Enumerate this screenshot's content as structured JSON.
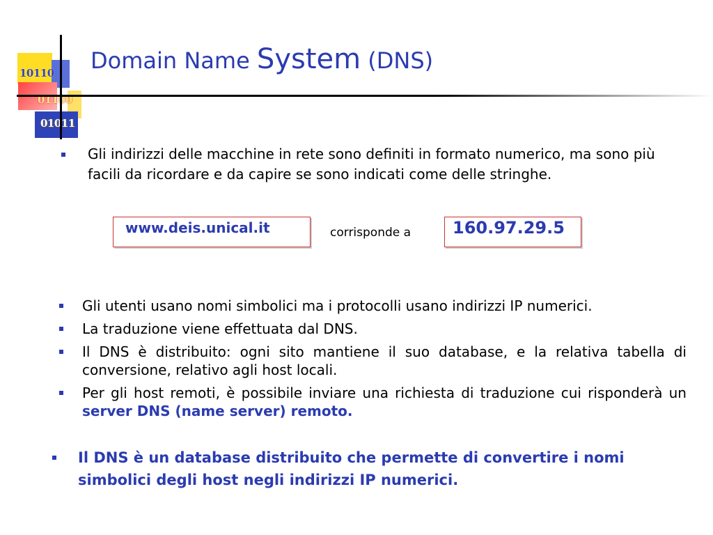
{
  "logo": {
    "binary_1": "10110",
    "binary_2": "01100",
    "binary_3": "01011"
  },
  "title": {
    "part1": "Domain Name ",
    "part2": "System",
    "part3": " (DNS)"
  },
  "intro_bullet": "Gli indirizzi delle macchine in rete sono definiti in formato numerico, ma sono più facili da ricordare e da capire se sono indicati come delle stringhe.",
  "example": {
    "hostname": "www.deis.unical.it",
    "connector": "corrisponde a",
    "ip_address": "160.97.29.5"
  },
  "bullets": [
    "Gli utenti usano nomi simbolici ma i protocolli usano indirizzi IP numerici.",
    "La traduzione viene effettuata dal DNS.",
    "Il DNS è distribuito: ogni sito mantiene il suo database, e la relativa tabella di conversione, relativo agli host locali."
  ],
  "bullet_last": {
    "text": "Per gli host remoti, è possibile inviare una richiesta di traduzione cui risponderà un ",
    "highlight": "server DNS (name server) remoto."
  },
  "conclusion": "Il DNS è un database distribuito che permette di convertire i nomi simbolici degli host negli indirizzi IP numerici.",
  "colors": {
    "accent": "#2b3bb0",
    "box_border": "#cc3333"
  }
}
